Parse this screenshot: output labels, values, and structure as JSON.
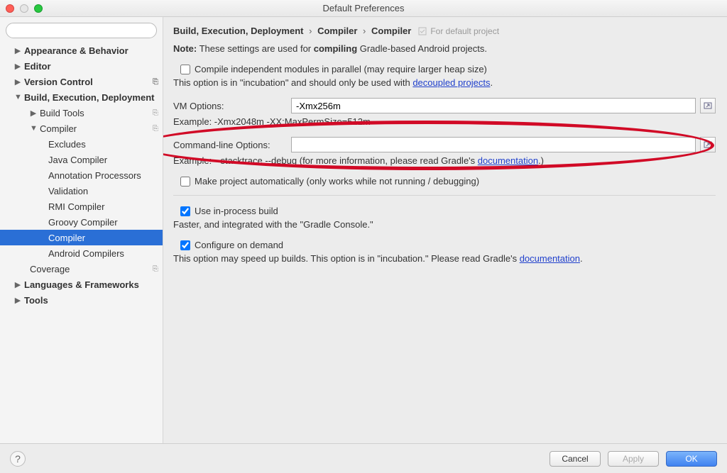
{
  "window": {
    "title": "Default Preferences"
  },
  "search": {
    "placeholder": ""
  },
  "sidebar": {
    "items": [
      {
        "label": "Appearance & Behavior",
        "level": 1,
        "arrow": "▶",
        "selected": false
      },
      {
        "label": "Editor",
        "level": 1,
        "arrow": "▶",
        "selected": false
      },
      {
        "label": "Version Control",
        "level": 1,
        "arrow": "▶",
        "selected": false,
        "badge": "⎘"
      },
      {
        "label": "Build, Execution, Deployment",
        "level": 1,
        "arrow": "▼",
        "selected": false
      },
      {
        "label": "Build Tools",
        "level": 2,
        "arrow": "▶",
        "selected": false,
        "badge": "⎘"
      },
      {
        "label": "Compiler",
        "level": 2,
        "arrow": "▼",
        "selected": false,
        "badge": "⎘"
      },
      {
        "label": "Excludes",
        "level": 3,
        "selected": false
      },
      {
        "label": "Java Compiler",
        "level": 3,
        "selected": false
      },
      {
        "label": "Annotation Processors",
        "level": 3,
        "selected": false
      },
      {
        "label": "Validation",
        "level": 3,
        "selected": false
      },
      {
        "label": "RMI Compiler",
        "level": 3,
        "selected": false
      },
      {
        "label": "Groovy Compiler",
        "level": 3,
        "selected": false
      },
      {
        "label": "Compiler",
        "level": 3,
        "selected": true
      },
      {
        "label": "Android Compilers",
        "level": 3,
        "selected": false
      },
      {
        "label": "Coverage",
        "level": 2,
        "selected": false,
        "badge": "⎘"
      },
      {
        "label": "Languages & Frameworks",
        "level": 1,
        "arrow": "▶",
        "selected": false
      },
      {
        "label": "Tools",
        "level": 1,
        "arrow": "▶",
        "selected": false
      }
    ]
  },
  "breadcrumb": {
    "part1": "Build, Execution, Deployment",
    "part2": "Compiler",
    "part3": "Compiler",
    "forProject": "For default project"
  },
  "note": {
    "prefix": "Note:",
    "before": " These settings are used for ",
    "bold": "compiling",
    "after": " Gradle-based Android projects."
  },
  "compileParallel": {
    "label": "Compile independent modules in parallel (may require larger heap size)",
    "checked": false
  },
  "incubation1": {
    "before": "This option is in \"incubation\" and should only be used with ",
    "link": "decoupled projects",
    "after": "."
  },
  "vmOptions": {
    "label": "VM Options:",
    "value": "-Xmx256m",
    "example": "Example: -Xmx2048m -XX:MaxPermSize=512m"
  },
  "cmdOptions": {
    "label": "Command-line Options:",
    "value": "",
    "exampleBefore": "Example: --stacktrace --debug (for more information, please read Gradle's ",
    "exampleLink": "documentation",
    "exampleAfter": ".)"
  },
  "makeAuto": {
    "label": "Make project automatically (only works while not running / debugging)",
    "checked": false
  },
  "inProcess": {
    "label": "Use in-process build",
    "checked": true,
    "desc": "Faster, and integrated with the \"Gradle Console.\""
  },
  "configureOnDemand": {
    "label": "Configure on demand",
    "checked": true,
    "descBefore": "This option may speed up builds. This option is in \"incubation.\" Please read Gradle's ",
    "descLink": "documentation",
    "descAfter": "."
  },
  "footer": {
    "cancel": "Cancel",
    "apply": "Apply",
    "ok": "OK"
  }
}
